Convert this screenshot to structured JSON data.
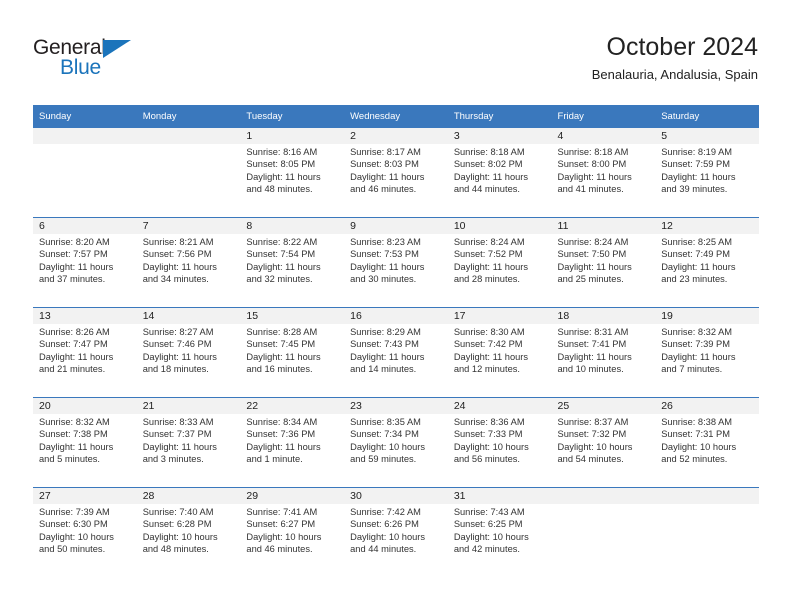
{
  "brand": {
    "name_top": "General",
    "name_bottom": "Blue",
    "color_primary": "#1b74bb",
    "color_header": "#3a78bd"
  },
  "header": {
    "title": "October 2024",
    "subtitle": "Benalauria, Andalusia, Spain"
  },
  "calendar": {
    "weekday_headers": [
      "Sunday",
      "Monday",
      "Tuesday",
      "Wednesday",
      "Thursday",
      "Friday",
      "Saturday"
    ],
    "weeks": [
      [
        {
          "day": "",
          "lines": []
        },
        {
          "day": "",
          "lines": []
        },
        {
          "day": "1",
          "lines": [
            "Sunrise: 8:16 AM",
            "Sunset: 8:05 PM",
            "Daylight: 11 hours",
            "and 48 minutes."
          ]
        },
        {
          "day": "2",
          "lines": [
            "Sunrise: 8:17 AM",
            "Sunset: 8:03 PM",
            "Daylight: 11 hours",
            "and 46 minutes."
          ]
        },
        {
          "day": "3",
          "lines": [
            "Sunrise: 8:18 AM",
            "Sunset: 8:02 PM",
            "Daylight: 11 hours",
            "and 44 minutes."
          ]
        },
        {
          "day": "4",
          "lines": [
            "Sunrise: 8:18 AM",
            "Sunset: 8:00 PM",
            "Daylight: 11 hours",
            "and 41 minutes."
          ]
        },
        {
          "day": "5",
          "lines": [
            "Sunrise: 8:19 AM",
            "Sunset: 7:59 PM",
            "Daylight: 11 hours",
            "and 39 minutes."
          ]
        }
      ],
      [
        {
          "day": "6",
          "lines": [
            "Sunrise: 8:20 AM",
            "Sunset: 7:57 PM",
            "Daylight: 11 hours",
            "and 37 minutes."
          ]
        },
        {
          "day": "7",
          "lines": [
            "Sunrise: 8:21 AM",
            "Sunset: 7:56 PM",
            "Daylight: 11 hours",
            "and 34 minutes."
          ]
        },
        {
          "day": "8",
          "lines": [
            "Sunrise: 8:22 AM",
            "Sunset: 7:54 PM",
            "Daylight: 11 hours",
            "and 32 minutes."
          ]
        },
        {
          "day": "9",
          "lines": [
            "Sunrise: 8:23 AM",
            "Sunset: 7:53 PM",
            "Daylight: 11 hours",
            "and 30 minutes."
          ]
        },
        {
          "day": "10",
          "lines": [
            "Sunrise: 8:24 AM",
            "Sunset: 7:52 PM",
            "Daylight: 11 hours",
            "and 28 minutes."
          ]
        },
        {
          "day": "11",
          "lines": [
            "Sunrise: 8:24 AM",
            "Sunset: 7:50 PM",
            "Daylight: 11 hours",
            "and 25 minutes."
          ]
        },
        {
          "day": "12",
          "lines": [
            "Sunrise: 8:25 AM",
            "Sunset: 7:49 PM",
            "Daylight: 11 hours",
            "and 23 minutes."
          ]
        }
      ],
      [
        {
          "day": "13",
          "lines": [
            "Sunrise: 8:26 AM",
            "Sunset: 7:47 PM",
            "Daylight: 11 hours",
            "and 21 minutes."
          ]
        },
        {
          "day": "14",
          "lines": [
            "Sunrise: 8:27 AM",
            "Sunset: 7:46 PM",
            "Daylight: 11 hours",
            "and 18 minutes."
          ]
        },
        {
          "day": "15",
          "lines": [
            "Sunrise: 8:28 AM",
            "Sunset: 7:45 PM",
            "Daylight: 11 hours",
            "and 16 minutes."
          ]
        },
        {
          "day": "16",
          "lines": [
            "Sunrise: 8:29 AM",
            "Sunset: 7:43 PM",
            "Daylight: 11 hours",
            "and 14 minutes."
          ]
        },
        {
          "day": "17",
          "lines": [
            "Sunrise: 8:30 AM",
            "Sunset: 7:42 PM",
            "Daylight: 11 hours",
            "and 12 minutes."
          ]
        },
        {
          "day": "18",
          "lines": [
            "Sunrise: 8:31 AM",
            "Sunset: 7:41 PM",
            "Daylight: 11 hours",
            "and 10 minutes."
          ]
        },
        {
          "day": "19",
          "lines": [
            "Sunrise: 8:32 AM",
            "Sunset: 7:39 PM",
            "Daylight: 11 hours",
            "and 7 minutes."
          ]
        }
      ],
      [
        {
          "day": "20",
          "lines": [
            "Sunrise: 8:32 AM",
            "Sunset: 7:38 PM",
            "Daylight: 11 hours",
            "and 5 minutes."
          ]
        },
        {
          "day": "21",
          "lines": [
            "Sunrise: 8:33 AM",
            "Sunset: 7:37 PM",
            "Daylight: 11 hours",
            "and 3 minutes."
          ]
        },
        {
          "day": "22",
          "lines": [
            "Sunrise: 8:34 AM",
            "Sunset: 7:36 PM",
            "Daylight: 11 hours",
            "and 1 minute."
          ]
        },
        {
          "day": "23",
          "lines": [
            "Sunrise: 8:35 AM",
            "Sunset: 7:34 PM",
            "Daylight: 10 hours",
            "and 59 minutes."
          ]
        },
        {
          "day": "24",
          "lines": [
            "Sunrise: 8:36 AM",
            "Sunset: 7:33 PM",
            "Daylight: 10 hours",
            "and 56 minutes."
          ]
        },
        {
          "day": "25",
          "lines": [
            "Sunrise: 8:37 AM",
            "Sunset: 7:32 PM",
            "Daylight: 10 hours",
            "and 54 minutes."
          ]
        },
        {
          "day": "26",
          "lines": [
            "Sunrise: 8:38 AM",
            "Sunset: 7:31 PM",
            "Daylight: 10 hours",
            "and 52 minutes."
          ]
        }
      ],
      [
        {
          "day": "27",
          "lines": [
            "Sunrise: 7:39 AM",
            "Sunset: 6:30 PM",
            "Daylight: 10 hours",
            "and 50 minutes."
          ]
        },
        {
          "day": "28",
          "lines": [
            "Sunrise: 7:40 AM",
            "Sunset: 6:28 PM",
            "Daylight: 10 hours",
            "and 48 minutes."
          ]
        },
        {
          "day": "29",
          "lines": [
            "Sunrise: 7:41 AM",
            "Sunset: 6:27 PM",
            "Daylight: 10 hours",
            "and 46 minutes."
          ]
        },
        {
          "day": "30",
          "lines": [
            "Sunrise: 7:42 AM",
            "Sunset: 6:26 PM",
            "Daylight: 10 hours",
            "and 44 minutes."
          ]
        },
        {
          "day": "31",
          "lines": [
            "Sunrise: 7:43 AM",
            "Sunset: 6:25 PM",
            "Daylight: 10 hours",
            "and 42 minutes."
          ]
        },
        {
          "day": "",
          "lines": []
        },
        {
          "day": "",
          "lines": []
        }
      ]
    ]
  }
}
